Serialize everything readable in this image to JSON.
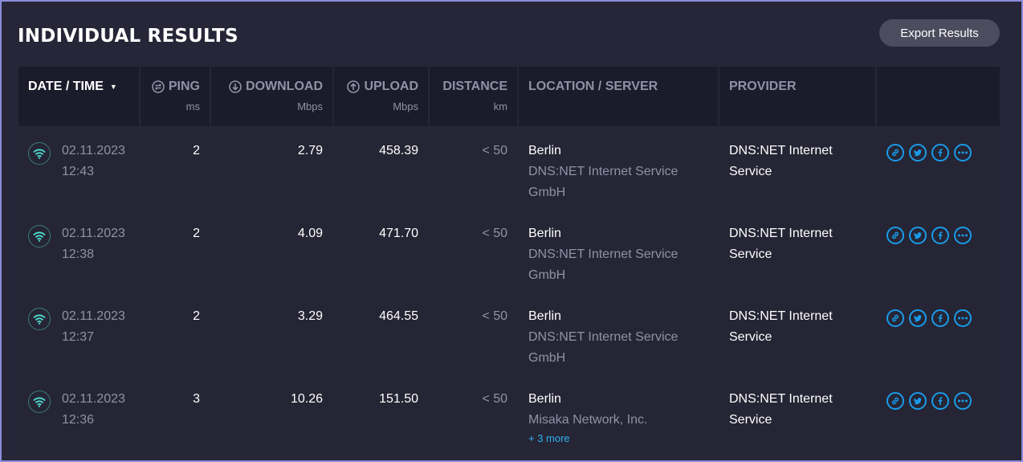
{
  "page": {
    "title": "INDIVIDUAL RESULTS",
    "export_label": "Export Results"
  },
  "columns": [
    {
      "label": "DATE / TIME",
      "unit": ""
    },
    {
      "label": "PING",
      "unit": "ms"
    },
    {
      "label": "DOWNLOAD",
      "unit": "Mbps"
    },
    {
      "label": "UPLOAD",
      "unit": "Mbps"
    },
    {
      "label": "DISTANCE",
      "unit": "km"
    },
    {
      "label": "LOCATION / SERVER",
      "unit": ""
    },
    {
      "label": "PROVIDER",
      "unit": ""
    }
  ],
  "rows": [
    {
      "date": "02.11.2023",
      "time": "12:43",
      "ping": "2",
      "download": "2.79",
      "upload": "458.39",
      "distance": "< 50",
      "location": "Berlin",
      "server": "DNS:NET Internet Service GmbH",
      "more": "",
      "provider": "DNS:NET Internet Service"
    },
    {
      "date": "02.11.2023",
      "time": "12:38",
      "ping": "2",
      "download": "4.09",
      "upload": "471.70",
      "distance": "< 50",
      "location": "Berlin",
      "server": "DNS:NET Internet Service GmbH",
      "more": "",
      "provider": "DNS:NET Internet Service"
    },
    {
      "date": "02.11.2023",
      "time": "12:37",
      "ping": "2",
      "download": "3.29",
      "upload": "464.55",
      "distance": "< 50",
      "location": "Berlin",
      "server": "DNS:NET Internet Service GmbH",
      "more": "",
      "provider": "DNS:NET Internet Service"
    },
    {
      "date": "02.11.2023",
      "time": "12:36",
      "ping": "3",
      "download": "10.26",
      "upload": "151.50",
      "distance": "< 50",
      "location": "Berlin",
      "server": "Misaka Network, Inc.",
      "more": "+ 3 more",
      "provider": "DNS:NET Internet Service"
    }
  ],
  "icons": {
    "connection": "wifi-icon",
    "share": [
      "link-icon",
      "twitter-icon",
      "facebook-icon",
      "more-icon"
    ]
  },
  "colors": {
    "accent": "#1a9be8",
    "wifi": "#4ee0d0",
    "button": "#4c4c5e",
    "header_bg": "#1b1b2b",
    "row_bg": "#252535"
  }
}
